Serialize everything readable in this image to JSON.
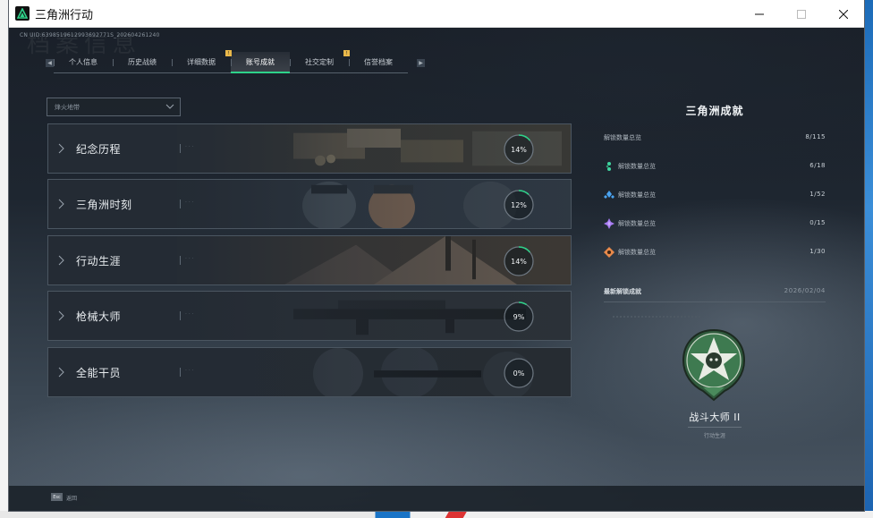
{
  "window": {
    "title": "三角洲行动",
    "controls": [
      "minimize",
      "maximize",
      "close"
    ]
  },
  "header": {
    "uid_text": "CN UID:6398519612993692771S_202604261240",
    "bg_title": "档案信息"
  },
  "tabs": [
    {
      "label": "个人信息",
      "active": false,
      "badge": false
    },
    {
      "label": "历史战绩",
      "active": false,
      "badge": false
    },
    {
      "label": "详细数据",
      "active": false,
      "badge": false
    },
    {
      "label": "账号成就",
      "active": true,
      "badge": true
    },
    {
      "label": "社交定制",
      "active": false,
      "badge": false
    },
    {
      "label": "信誉档案",
      "active": false,
      "badge": true
    }
  ],
  "tab_badge_text": "!",
  "dropdown": {
    "value": "烽火地带"
  },
  "categories": [
    {
      "label": "纪念历程",
      "progress": "14%",
      "fraction": 0.14
    },
    {
      "label": "三角洲时刻",
      "progress": "12%",
      "fraction": 0.12
    },
    {
      "label": "行动生涯",
      "progress": "14%",
      "fraction": 0.14
    },
    {
      "label": "枪械大师",
      "progress": "9%",
      "fraction": 0.09
    },
    {
      "label": "全能干员",
      "progress": "0%",
      "fraction": 0.0
    }
  ],
  "panel": {
    "title": "三角洲成就",
    "total": {
      "label": "解锁数量总览",
      "value": "8/115"
    },
    "tiers": [
      {
        "label": "解锁数量总览",
        "value": "6/18",
        "icon": "green-gem-icon",
        "color": "#3fd6a0"
      },
      {
        "label": "解锁数量总览",
        "value": "1/52",
        "icon": "blue-gem-icon",
        "color": "#4aa3f0"
      },
      {
        "label": "解锁数量总览",
        "value": "0/15",
        "icon": "purple-gem-icon",
        "color": "#a77bf2"
      },
      {
        "label": "解锁数量总览",
        "value": "1/30",
        "icon": "orange-gem-icon",
        "color": "#e8894a"
      }
    ],
    "recent": {
      "label": "最新解锁成就",
      "date": "2026/02/04"
    },
    "emblem": {
      "name": "战斗大师 II",
      "category": "行动生涯"
    }
  },
  "bottombar": {
    "key": "Esc",
    "label": "返回"
  }
}
